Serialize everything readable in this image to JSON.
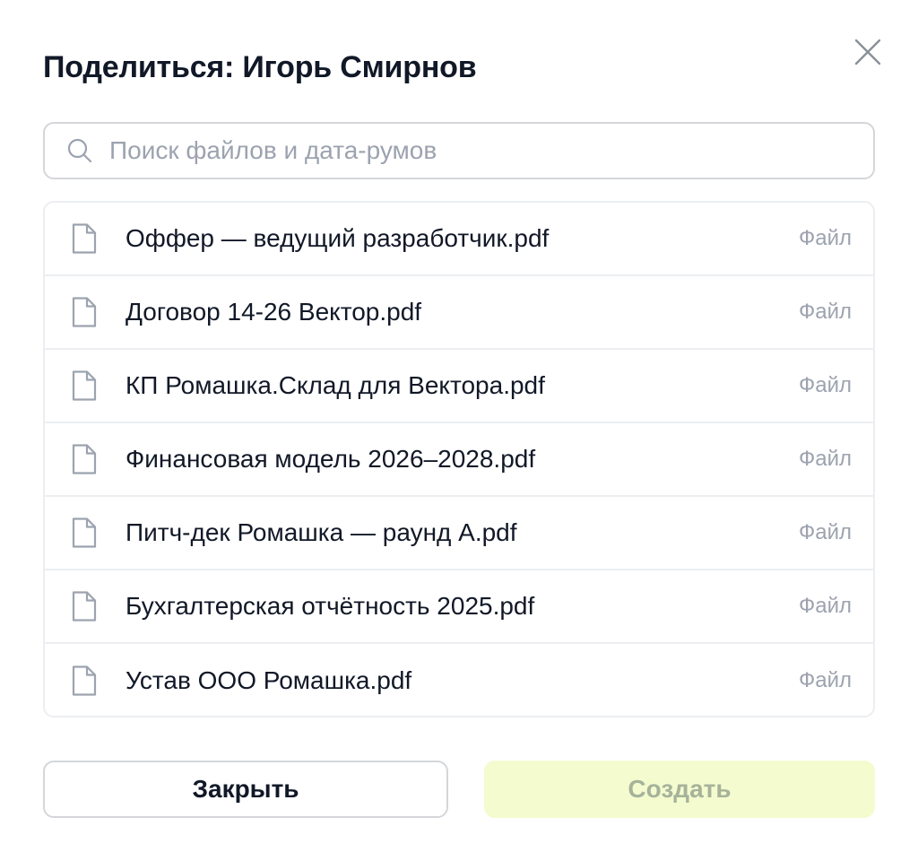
{
  "dialog": {
    "title": "Поделиться: Игорь Смирнов",
    "close_icon": "close-icon"
  },
  "search": {
    "icon": "search-icon",
    "placeholder": "Поиск файлов и дата-румов",
    "value": ""
  },
  "files": [
    {
      "name": "Оффер — ведущий разработчик.pdf",
      "type": "Файл",
      "icon": "file-icon"
    },
    {
      "name": "Договор 14-26 Вектор.pdf",
      "type": "Файл",
      "icon": "file-icon"
    },
    {
      "name": "КП Ромашка.Склад для Вектора.pdf",
      "type": "Файл",
      "icon": "file-icon"
    },
    {
      "name": "Финансовая модель 2026–2028.pdf",
      "type": "Файл",
      "icon": "file-icon"
    },
    {
      "name": "Питч-дек Ромашка — раунд А.pdf",
      "type": "Файл",
      "icon": "file-icon"
    },
    {
      "name": "Бухгалтерская отчётность 2025.pdf",
      "type": "Файл",
      "icon": "file-icon"
    },
    {
      "name": "Устав ООО Ромашка.pdf",
      "type": "Файл",
      "icon": "file-icon"
    }
  ],
  "actions": {
    "close_label": "Закрыть",
    "create_label": "Создать",
    "create_disabled": true
  },
  "colors": {
    "title_text": "#111827",
    "muted_text": "#9ca3af",
    "border": "#d4d6da",
    "row_divider": "#eceef1",
    "create_bg_disabled": "#f4fccf",
    "create_text_disabled": "#a7b29a"
  }
}
